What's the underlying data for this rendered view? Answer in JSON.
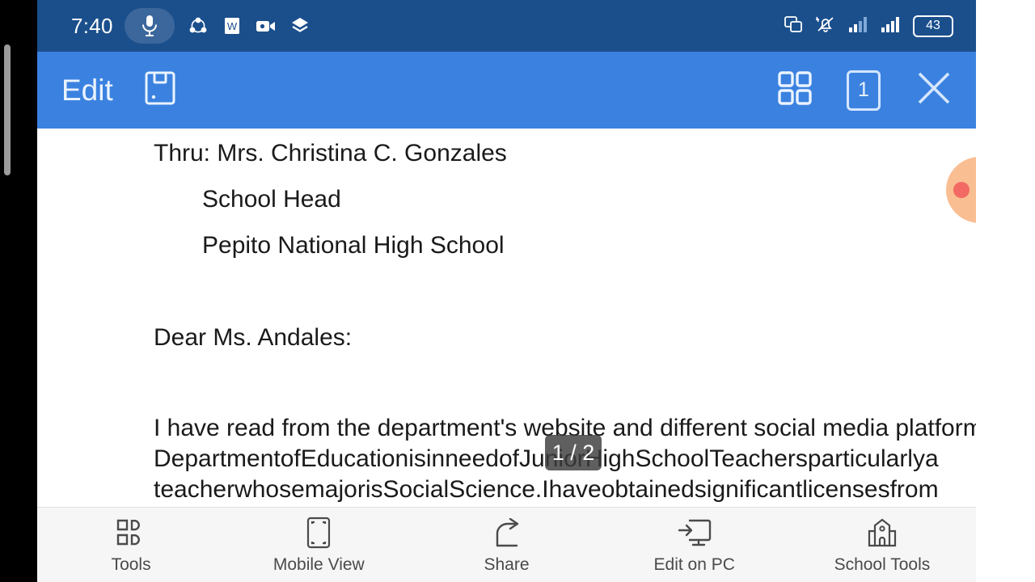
{
  "status_bar": {
    "time": "7:40",
    "mic_icon": "microphone-icon",
    "notification_icons": [
      "sync-share-icon",
      "wps-document-icon",
      "video-camera-icon",
      "layers-diamond-icon"
    ],
    "right_icons": [
      "cast-screen-icon",
      "notifications-muted-icon",
      "signal-bars-sim1-icon",
      "signal-bars-sim2-icon"
    ],
    "battery_level": "43",
    "background_color": "#1b4f8c"
  },
  "app_bar": {
    "edit_label": "Edit",
    "save_icon": "floppy-save-icon",
    "grid_icon": "grid-view-icon",
    "page_number": "1",
    "close_icon": "close-x-icon",
    "background_color": "#3b82e0"
  },
  "document": {
    "lines": {
      "thru": "Thru: Mrs. Christina  C. Gonzales",
      "school_head": "School Head",
      "school_name": "Pepito  National High School",
      "salutation": "Dear Ms. Andales:"
    },
    "paragraph": {
      "line1": "I have read from the department's website and different social media platforms that the",
      "line2_words": [
        "Department",
        "of",
        "Education",
        "is",
        "in",
        "need",
        "of",
        "Junior",
        "High",
        "School",
        "Teachers",
        "particularly",
        "a"
      ],
      "line3_words": [
        "teacher",
        "whose",
        "major",
        "is",
        "Social",
        "Science.",
        "I",
        "have",
        "obtained",
        "significant",
        "licenses",
        "from"
      ]
    }
  },
  "page_indicator": {
    "label": "1 / 2"
  },
  "floating_widget": {
    "name": "floating-assistant-widget"
  },
  "bottom_bar": {
    "items": [
      {
        "label": "Tools",
        "icon": "tools-grid-icon"
      },
      {
        "label": "Mobile View",
        "icon": "mobile-view-icon"
      },
      {
        "label": "Share",
        "icon": "share-arrow-icon"
      },
      {
        "label": "Edit on PC",
        "icon": "edit-on-pc-icon"
      },
      {
        "label": "School Tools",
        "icon": "school-building-icon"
      }
    ]
  },
  "nav_bar": {
    "back": "back-triangle-icon",
    "home": "home-square-icon",
    "recents": "recents-lines-icon"
  }
}
